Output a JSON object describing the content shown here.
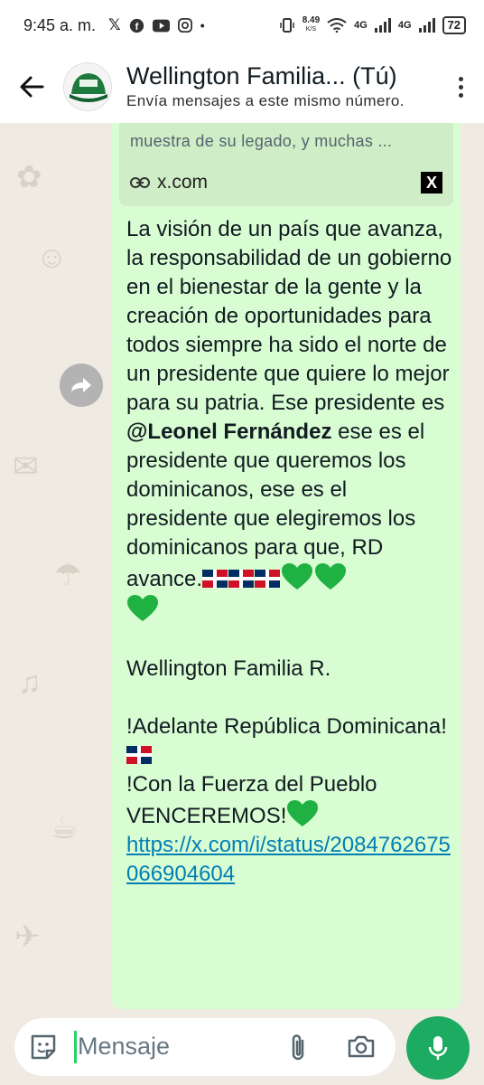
{
  "status_bar": {
    "time": "9:45 a. m.",
    "app_icons": [
      "x-icon",
      "facebook-icon",
      "youtube-icon",
      "instagram-icon"
    ],
    "dot": "•",
    "speed_value": "8.49",
    "speed_unit": "K/S",
    "network_1": "4G",
    "network_2": "4G",
    "battery": "72"
  },
  "header": {
    "title": "Wellington Familia... (Tú)",
    "subtitle": "Envía mensajes a este mismo número."
  },
  "link_preview": {
    "description": "muestra de su legado, y muchas ...",
    "domain": "x.com",
    "logo_letter": "X"
  },
  "message": {
    "para1_before_mention": "La visión de un país que avanza, la responsabilidad de un gobierno en el bienestar de la gente y la creación de oportunidades para todos siempre ha sido el norte de un presidente que quiere lo mejor para su patria. Ese presidente es ",
    "mention": "@Leonel Fernández",
    "para1_after_mention": " ese es el presidente que queremos los dominicanos, ese es el presidente que elegiremos los dominicanos para que, RD avance.",
    "signature": "Wellington Familia R.",
    "slogan1": "!Adelante República Dominicana!",
    "slogan2": "!Con la Fuerza del Pueblo VENCEREMOS!",
    "url": "https://x.com/i/status/2084762675066904604"
  },
  "input": {
    "placeholder": "Mensaje"
  },
  "colors": {
    "bubble": "#d9fdd3",
    "preview": "#cfedc6",
    "link": "#027eb5",
    "mic": "#1daa61",
    "heart": "#1fb141",
    "chat_bg": "#efeae2"
  }
}
